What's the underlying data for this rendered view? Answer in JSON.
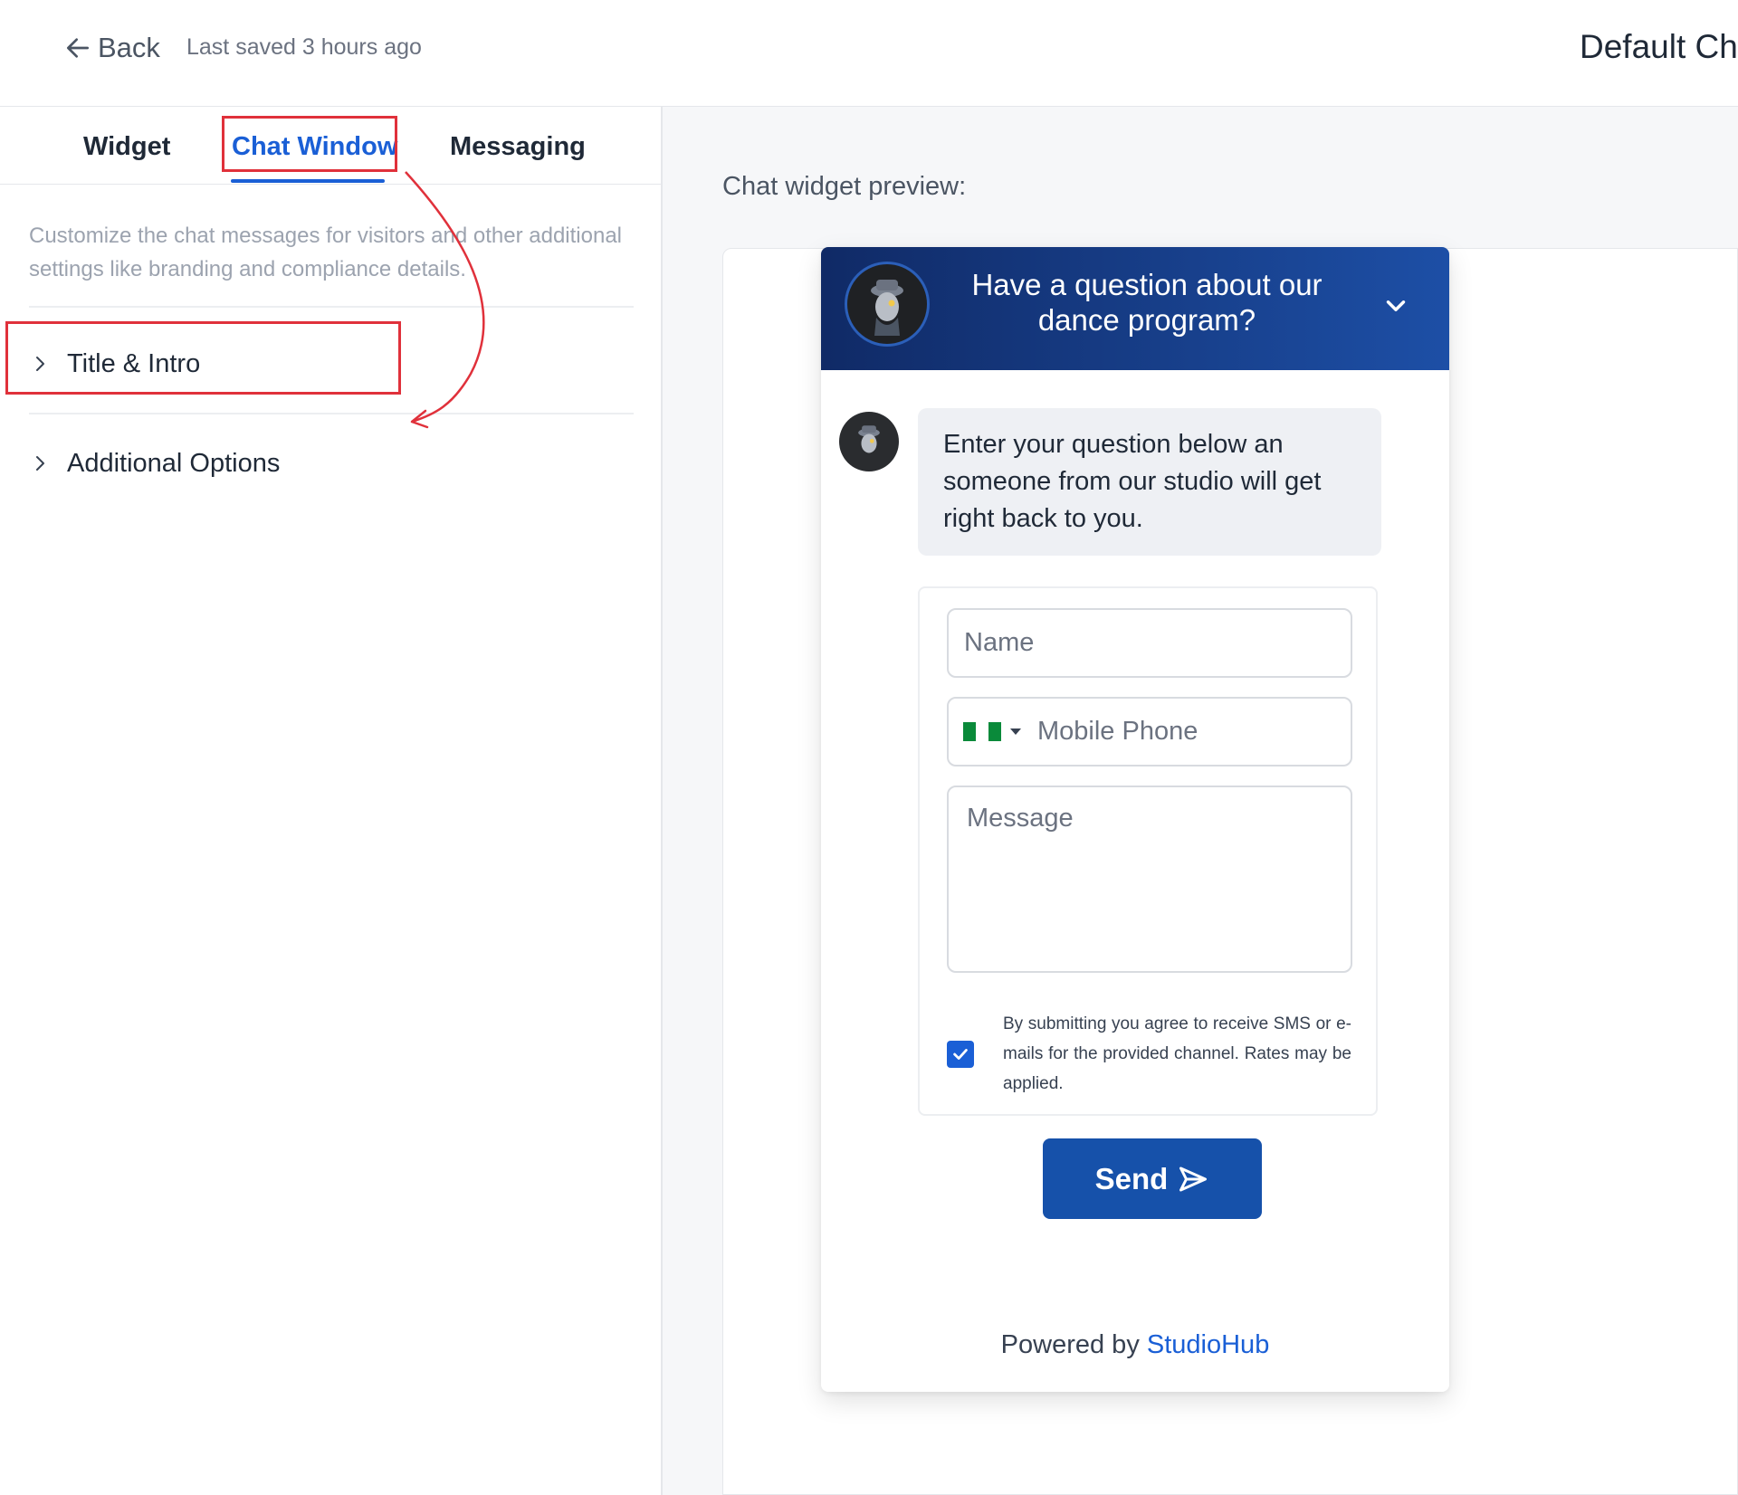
{
  "topbar": {
    "back_label": "Back",
    "last_saved": "Last saved 3 hours ago",
    "page_title": "Default Ch"
  },
  "tabs": [
    {
      "label": "Widget"
    },
    {
      "label": "Chat Window",
      "active": true
    },
    {
      "label": "Messaging"
    }
  ],
  "settings": {
    "description": "Customize the chat messages for visitors and other additional settings like branding and compliance details.",
    "sections": [
      {
        "label": "Title & Intro"
      },
      {
        "label": "Additional Options"
      }
    ]
  },
  "preview": {
    "label": "Chat widget preview:"
  },
  "chat_widget": {
    "header_title": "Have a question about our dance program?",
    "intro_message": "Enter your question below an someone from our studio will get right back to you.",
    "form": {
      "name_placeholder": "Name",
      "phone_placeholder": "Mobile Phone",
      "message_placeholder": "Message",
      "consent_checked": true,
      "consent_text": "By submitting you agree to receive SMS or e-mails for the provided channel. Rates may be applied."
    },
    "send_label": "Send",
    "powered_by_prefix": "Powered by",
    "brand_name": "StudioHub"
  },
  "colors": {
    "accent": "#1a5fd6",
    "header_gradient_start": "#102a66",
    "header_gradient_end": "#1d4fa6",
    "send_button": "#1651aa",
    "annotation": "#e0313b"
  },
  "icons": {
    "back": "arrow-left-icon",
    "section_toggle": "chevron-right-icon",
    "header_toggle": "chevron-down-icon",
    "send": "send-icon",
    "consent": "checkmark-icon"
  }
}
